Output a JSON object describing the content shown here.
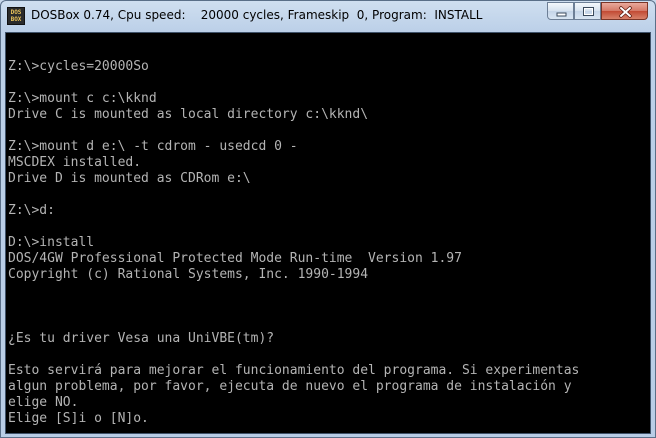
{
  "window": {
    "title": "DOSBox 0.74, Cpu speed:    20000 cycles, Frameskip  0, Program:  INSTALL",
    "icon_label": "DOS BOX",
    "controls": {
      "minimize": "minimize-icon",
      "maximize": "maximize-icon",
      "close": "close-icon"
    }
  },
  "console": {
    "text_color": "#b4b4b4",
    "background": "#000000",
    "lines": [
      "",
      "Z:\\>cycles=20000So",
      "",
      "Z:\\>mount c c:\\kknd",
      "Drive C is mounted as local directory c:\\kknd\\",
      "",
      "Z:\\>mount d e:\\ -t cdrom - usedcd 0 -",
      "MSCDEX installed.",
      "Drive D is mounted as CDRom e:\\",
      "",
      "Z:\\>d:",
      "",
      "D:\\>install",
      "DOS/4GW Professional Protected Mode Run-time  Version 1.97",
      "Copyright (c) Rational Systems, Inc. 1990-1994",
      "",
      "",
      "",
      "¿Es tu driver Vesa una UniVBE(tm)?",
      "",
      "Esto servirá para mejorar el funcionamiento del programa. Si experimentas",
      "algun problema, por favor, ejecuta de nuevo el programa de instalación y",
      "elige NO.",
      "Elige [S]i o [N]o."
    ]
  }
}
